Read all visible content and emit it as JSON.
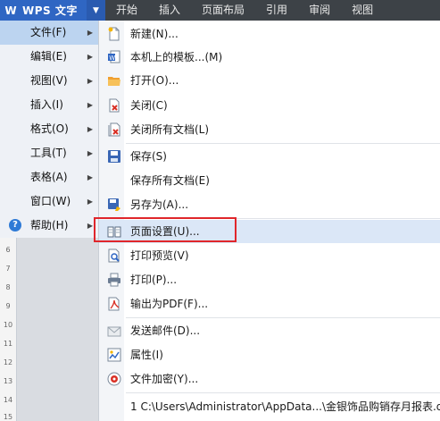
{
  "app": {
    "title": "WPS 文字"
  },
  "tabs": [
    "开始",
    "插入",
    "页面布局",
    "引用",
    "审阅",
    "视图"
  ],
  "main_menu": [
    {
      "label": "文件(F)",
      "active": true
    },
    {
      "label": "编辑(E)"
    },
    {
      "label": "视图(V)"
    },
    {
      "label": "插入(I)"
    },
    {
      "label": "格式(O)"
    },
    {
      "label": "工具(T)"
    },
    {
      "label": "表格(A)"
    },
    {
      "label": "窗口(W)"
    },
    {
      "label": "帮助(H)"
    }
  ],
  "file_menu": {
    "new": {
      "label": "新建(N)...",
      "shortcut": "C"
    },
    "template": {
      "label": "本机上的模板...(M)"
    },
    "open": {
      "label": "打开(O)...",
      "shortcut": "C"
    },
    "close": {
      "label": "关闭(C)"
    },
    "close_all": {
      "label": "关闭所有文档(L)"
    },
    "save": {
      "label": "保存(S)",
      "shortcut": "C"
    },
    "save_all": {
      "label": "保存所有文档(E)"
    },
    "save_as": {
      "label": "另存为(A)..."
    },
    "page_setup": {
      "label": "页面设置(U)..."
    },
    "print_preview": {
      "label": "打印预览(V)"
    },
    "print": {
      "label": "打印(P)...",
      "shortcut": "C"
    },
    "export_pdf": {
      "label": "输出为PDF(F)..."
    },
    "send_mail": {
      "label": "发送邮件(D)..."
    },
    "properties": {
      "label": "属性(I)"
    },
    "encrypt": {
      "label": "文件加密(Y)..."
    },
    "recent_1": {
      "label": "1 C:\\Users\\Administrator\\AppData...\\金银饰品购销存月报表.do"
    }
  },
  "ruler_ticks": [
    "6",
    "7",
    "8",
    "9",
    "10",
    "11",
    "12",
    "13",
    "14",
    "15"
  ],
  "colors": {
    "accent": "#2f66c3",
    "highlight_box": "#e0262b",
    "topbar": "#3d4247"
  }
}
